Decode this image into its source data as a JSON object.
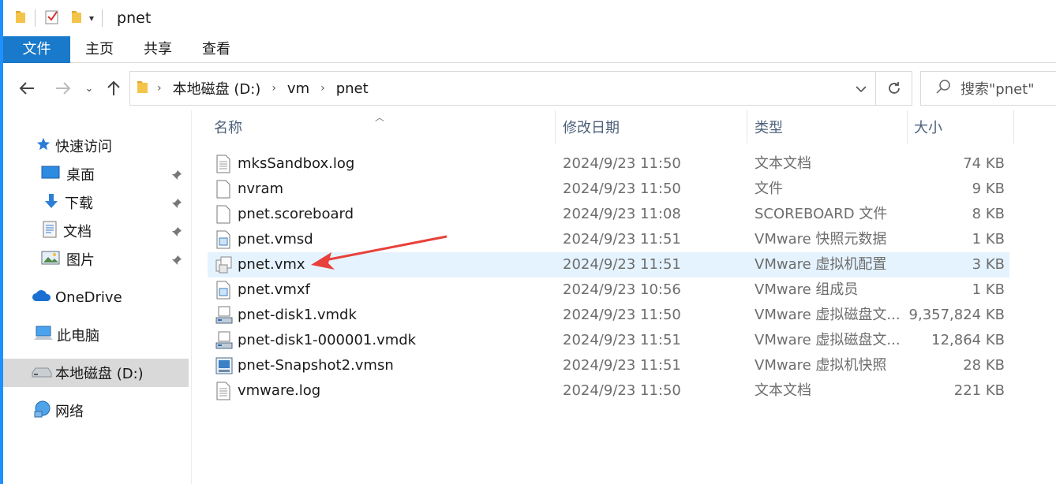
{
  "window": {
    "title": "pnet",
    "accent_color": "#1979ca"
  },
  "ribbon": {
    "tabs": [
      "文件",
      "主页",
      "共享",
      "查看"
    ]
  },
  "address": {
    "crumbs": [
      "本地磁盘 (D:)",
      "vm",
      "pnet"
    ],
    "search_placeholder": "搜索\"pnet\""
  },
  "sidebar": {
    "items": [
      {
        "label": "快速访问",
        "icon": "star-icon",
        "pinned": false
      },
      {
        "label": "桌面",
        "icon": "desktop-icon",
        "pinned": true
      },
      {
        "label": "下载",
        "icon": "download-arrow-icon",
        "pinned": true
      },
      {
        "label": "文档",
        "icon": "document-icon",
        "pinned": true
      },
      {
        "label": "图片",
        "icon": "picture-icon",
        "pinned": true
      },
      {
        "label": "OneDrive",
        "icon": "cloud-icon",
        "pinned": false
      },
      {
        "label": "此电脑",
        "icon": "computer-icon",
        "pinned": false
      },
      {
        "label": "本地磁盘 (D:)",
        "icon": "drive-icon",
        "pinned": false,
        "selected": true
      },
      {
        "label": "网络",
        "icon": "network-icon",
        "pinned": false
      }
    ]
  },
  "filelist": {
    "columns": [
      "名称",
      "修改日期",
      "类型",
      "大小"
    ],
    "files": [
      {
        "name": "mksSandbox.log",
        "date": "2024/9/23 11:50",
        "type": "文本文档",
        "size": "74 KB",
        "icon": "text-file-icon"
      },
      {
        "name": "nvram",
        "date": "2024/9/23 11:50",
        "type": "文件",
        "size": "9 KB",
        "icon": "blank-file-icon"
      },
      {
        "name": "pnet.scoreboard",
        "date": "2024/9/23 11:08",
        "type": "SCOREBOARD 文件",
        "size": "8 KB",
        "icon": "blank-file-icon"
      },
      {
        "name": "pnet.vmsd",
        "date": "2024/9/23 11:51",
        "type": "VMware 快照元数据",
        "size": "1 KB",
        "icon": "vmware-file-icon"
      },
      {
        "name": "pnet.vmx",
        "date": "2024/9/23 11:51",
        "type": "VMware 虚拟机配置",
        "size": "3 KB",
        "icon": "vmx-file-icon",
        "selected": true
      },
      {
        "name": "pnet.vmxf",
        "date": "2024/9/23 10:56",
        "type": "VMware 组成员",
        "size": "1 KB",
        "icon": "vmware-file-icon"
      },
      {
        "name": "pnet-disk1.vmdk",
        "date": "2024/9/23 11:50",
        "type": "VMware 虚拟磁盘文...",
        "size": "9,357,824 KB",
        "icon": "disk-file-icon"
      },
      {
        "name": "pnet-disk1-000001.vmdk",
        "date": "2024/9/23 11:51",
        "type": "VMware 虚拟磁盘文...",
        "size": "12,864 KB",
        "icon": "disk-file-icon"
      },
      {
        "name": "pnet-Snapshot2.vmsn",
        "date": "2024/9/23 11:51",
        "type": "VMware 虚拟机快照",
        "size": "28 KB",
        "icon": "snapshot-file-icon"
      },
      {
        "name": "vmware.log",
        "date": "2024/9/23 11:50",
        "type": "文本文档",
        "size": "221 KB",
        "icon": "text-file-icon"
      }
    ]
  },
  "annotation": {
    "icon": "red-arrow-icon",
    "color": "#e8403a"
  }
}
